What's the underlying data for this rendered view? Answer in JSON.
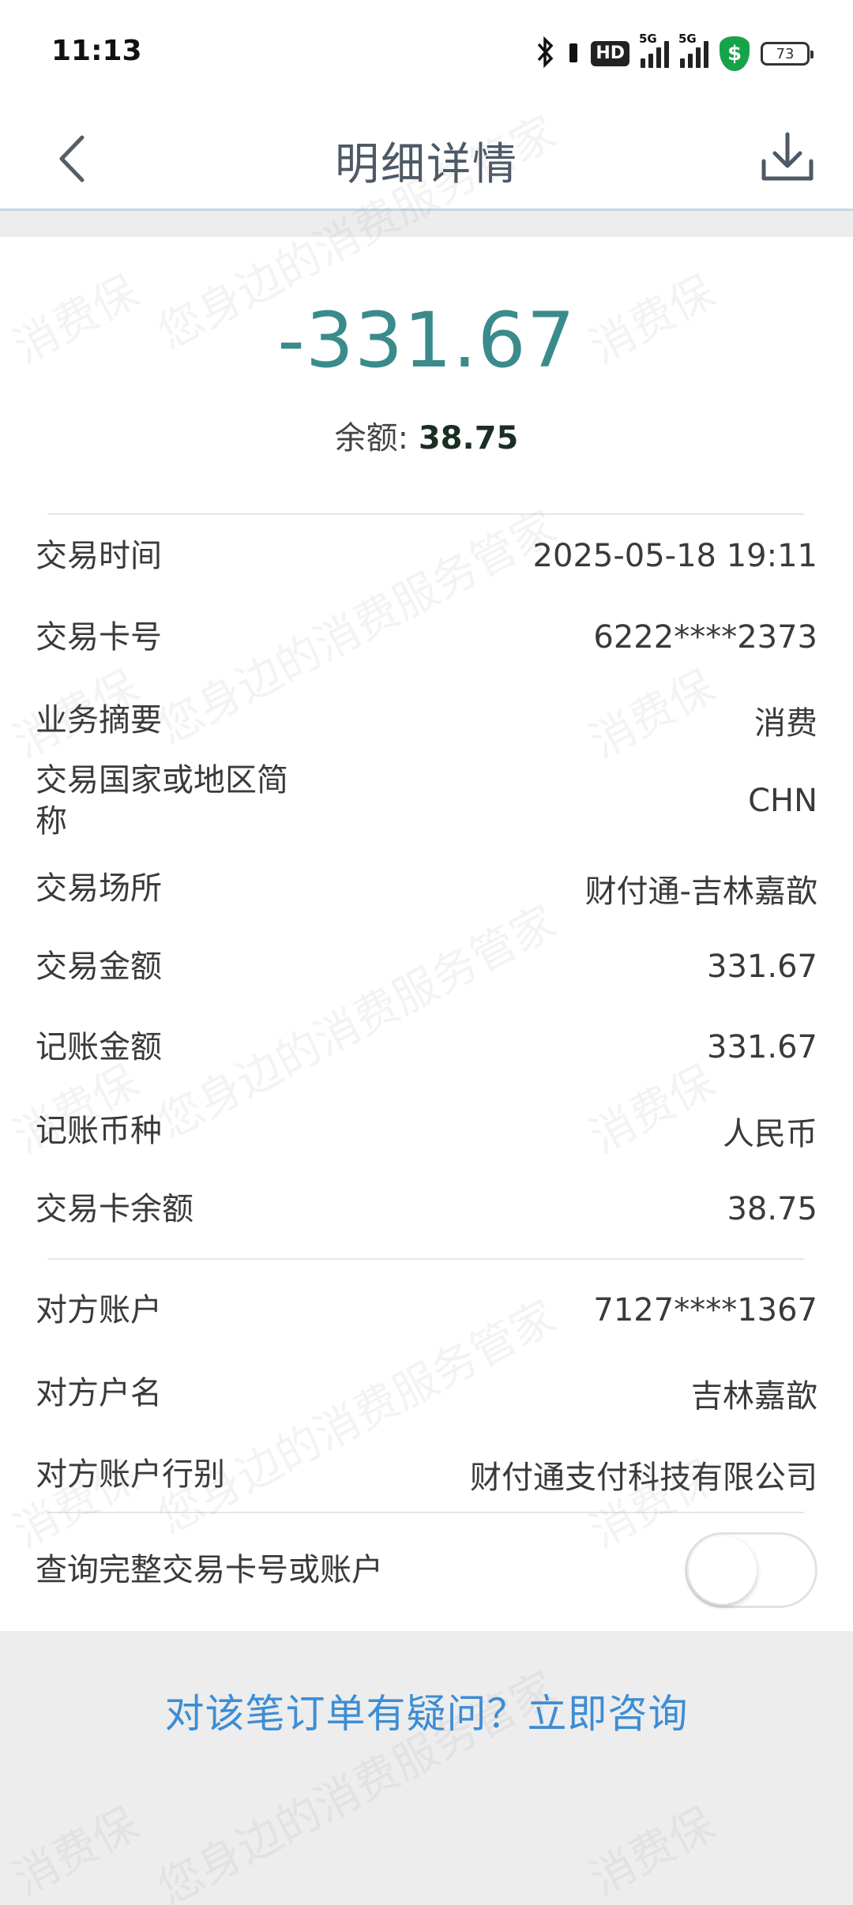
{
  "status": {
    "time": "11:13",
    "hd": "HD",
    "net1": "5G",
    "net2": "5G",
    "battery": "73",
    "icons": [
      "bluetooth-icon",
      "vibrate-icon",
      "hd-icon",
      "signal-icon",
      "signal-icon",
      "shield-icon",
      "battery-icon"
    ]
  },
  "nav": {
    "title": "明细详情",
    "back_icon": "chevron-left-icon",
    "download_icon": "download-icon"
  },
  "summary": {
    "amount": "-331.67",
    "balance_label": "余额: ",
    "balance_value": "38.75",
    "amount_color": "#3a8b8b"
  },
  "details": [
    {
      "label": "交易时间",
      "value": "2025-05-18 19:11"
    },
    {
      "label": "交易卡号",
      "value": "6222****2373"
    },
    {
      "label": "业务摘要",
      "value": "消费"
    },
    {
      "label": "交易国家或地区简称",
      "value": "CHN"
    },
    {
      "label": "交易场所",
      "value": "财付通-吉林嘉歆"
    },
    {
      "label": "交易金额",
      "value": "331.67"
    },
    {
      "label": "记账金额",
      "value": "331.67"
    },
    {
      "label": "记账币种",
      "value": "人民币"
    },
    {
      "label": "交易卡余额",
      "value": "38.75"
    }
  ],
  "counterparty": [
    {
      "label": "对方账户",
      "value": "7127****1367"
    },
    {
      "label": "对方户名",
      "value": "吉林嘉歆"
    },
    {
      "label": "对方账户行别",
      "value": "财付通支付科技有限公司"
    }
  ],
  "toggle": {
    "label": "查询完整交易卡号或账户",
    "state": "off"
  },
  "consult": {
    "text": "对该笔订单有疑问？立即咨询",
    "color": "#3d8dd4"
  },
  "watermark": {
    "text1": "消费保",
    "text2": "您身边的消费服务管家"
  }
}
